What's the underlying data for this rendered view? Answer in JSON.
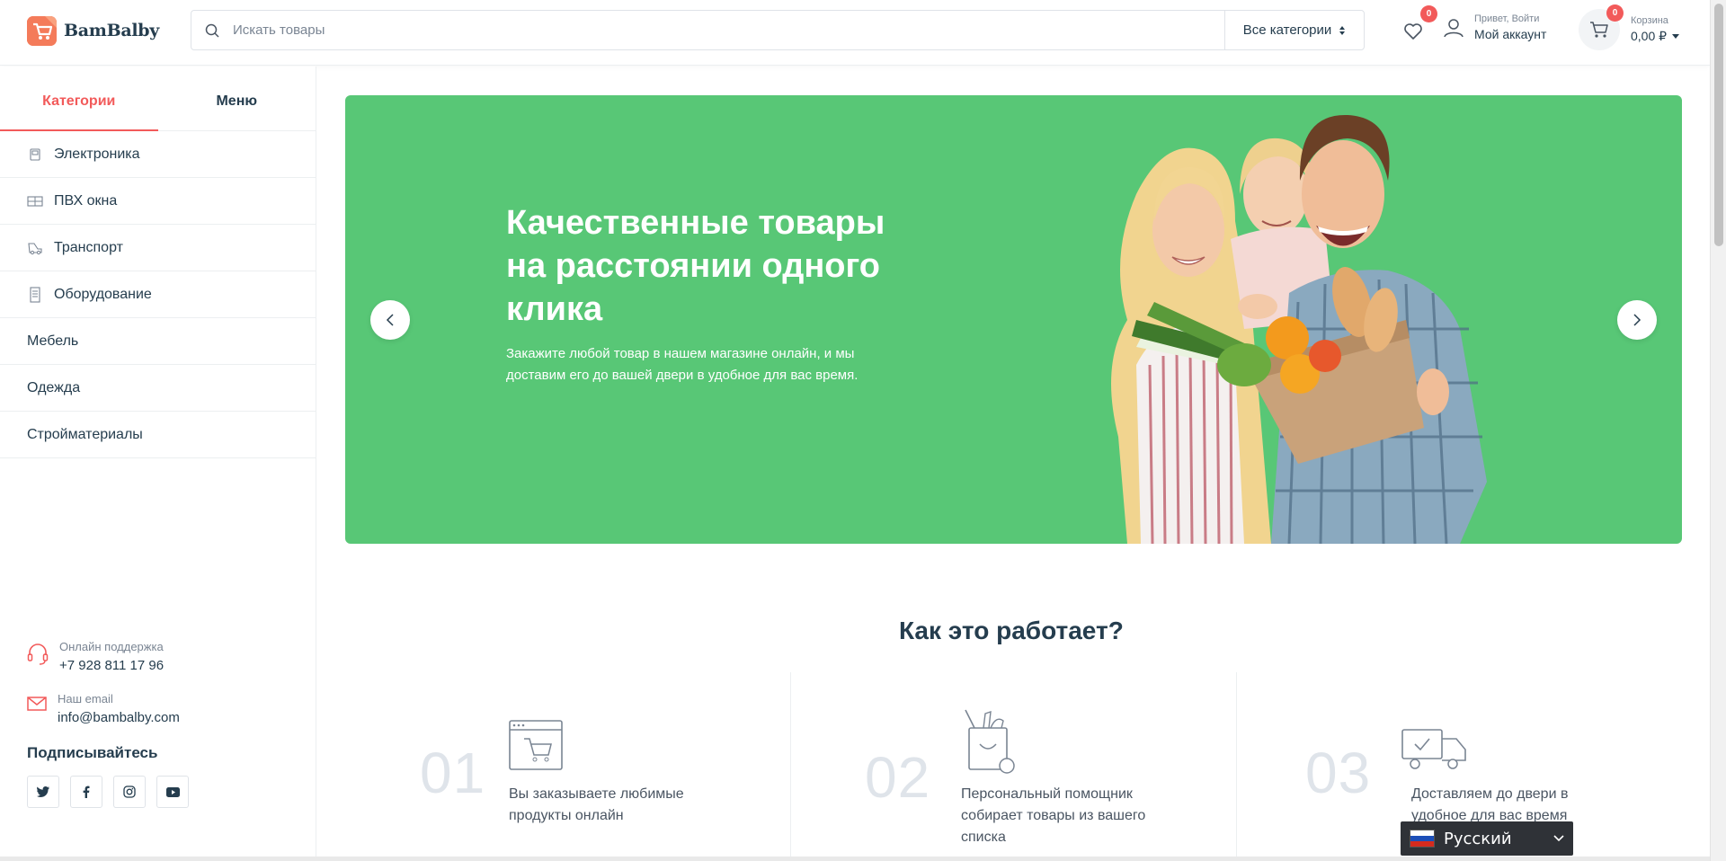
{
  "header": {
    "logo_text": "BamBalby",
    "search_placeholder": "Искать товары",
    "category_select": "Все категории",
    "wishlist_count": "0",
    "account_greeting": "Привет, Войти",
    "account_label": "Мой аккаунт",
    "cart_count": "0",
    "cart_label": "Корзина",
    "cart_total": "0,00 ₽"
  },
  "sidebar": {
    "tabs": [
      {
        "label": "Категории",
        "active": true
      },
      {
        "label": "Меню",
        "active": false
      }
    ],
    "categories": [
      {
        "label": "Электроника",
        "icon": "electronics-icon"
      },
      {
        "label": "ПВХ окна",
        "icon": "window-icon"
      },
      {
        "label": "Транспорт",
        "icon": "transport-icon"
      },
      {
        "label": "Оборудование",
        "icon": "equipment-icon"
      },
      {
        "label": "Мебель",
        "icon": ""
      },
      {
        "label": "Одежда",
        "icon": ""
      },
      {
        "label": "Стройматериалы",
        "icon": ""
      }
    ],
    "support_label": "Онлайн поддержка",
    "support_phone": "+7 928 811 17 96",
    "email_label": "Наш email",
    "email_value": "info@bambalby.com",
    "subscribe_title": "Подписывайтесь",
    "socials": [
      "twitter-icon",
      "facebook-icon",
      "instagram-icon",
      "youtube-icon"
    ]
  },
  "hero": {
    "title": "Качественные товары на расстоянии одного клика",
    "subtitle": "Закажите любой товар в нашем магазине онлайн, и мы доставим его до вашей двери в удобное для вас время.",
    "background_color": "#58c776"
  },
  "how_it_works": {
    "title": "Как это работает?",
    "steps": [
      {
        "number": "01",
        "text": "Вы заказываете любимые продукты онлайн",
        "icon": "online-cart-icon"
      },
      {
        "number": "02",
        "text": "Персональный помощник собирает товары из вашего списка",
        "icon": "grocery-bag-icon"
      },
      {
        "number": "03",
        "text": "Доставляем до двери в удобное для вас время",
        "icon": "delivery-truck-icon"
      }
    ]
  },
  "language": {
    "label": "Русский"
  },
  "colors": {
    "accent": "#f25a5a",
    "text": "#253d4e",
    "hero_green": "#58c776"
  }
}
